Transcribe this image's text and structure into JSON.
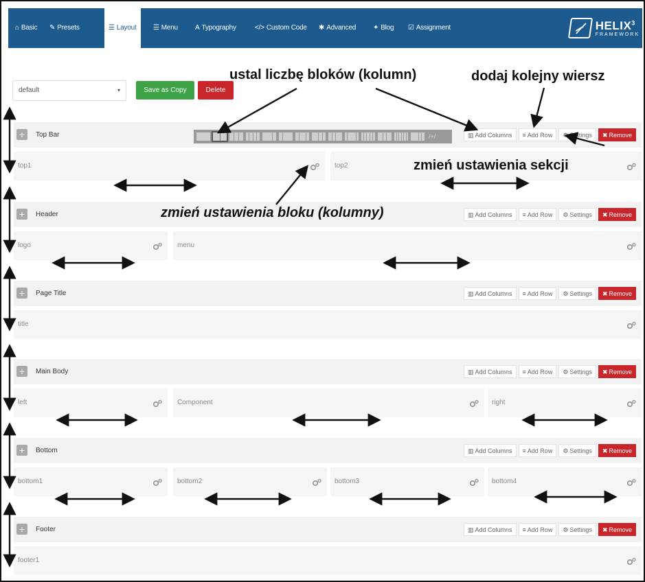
{
  "nav": {
    "items": [
      {
        "label": "Basic",
        "icon": "home-icon"
      },
      {
        "label": "Presets",
        "icon": "brush-icon"
      },
      {
        "label": "Layout",
        "icon": "layout-icon",
        "active": true
      },
      {
        "label": "Menu",
        "icon": "menu-icon"
      },
      {
        "label": "Typography",
        "icon": "font-icon"
      },
      {
        "label": "Custom Code",
        "icon": "code-icon"
      },
      {
        "label": "Advanced",
        "icon": "gear-icon"
      },
      {
        "label": "Blog",
        "icon": "thumbtack-icon"
      },
      {
        "label": "Assignment",
        "icon": "check-square-icon"
      }
    ],
    "logo": {
      "brand": "HELIX",
      "sub": "FRAMEWORK",
      "superscript": "3"
    }
  },
  "toolbar": {
    "layout_value": "default",
    "save_copy_label": "Save as Copy",
    "delete_label": "Delete"
  },
  "actions": {
    "add_columns": "Add Columns",
    "add_row": "Add Row",
    "settings": "Settings",
    "remove": "Remove"
  },
  "presets": {
    "custom_label": "/+/"
  },
  "sections": [
    {
      "title": "Top Bar",
      "columns": [
        "top1",
        "top2"
      ]
    },
    {
      "title": "Header",
      "columns": [
        "logo",
        "menu"
      ]
    },
    {
      "title": "Page Title",
      "columns": [
        "title"
      ]
    },
    {
      "title": "Main Body",
      "columns": [
        "left",
        "Component",
        "right"
      ]
    },
    {
      "title": "Bottom",
      "columns": [
        "bottom1",
        "bottom2",
        "bottom3",
        "bottom4"
      ]
    },
    {
      "title": "Footer",
      "columns": [
        "footer1"
      ]
    }
  ],
  "annotations": {
    "columns_count": "ustal liczbę bloków (kolumn)",
    "add_row": "dodaj kolejny wiersz",
    "section_settings": "zmień ustawienia sekcji",
    "block_settings": "zmień ustawienia bloku (kolumny)"
  },
  "colors": {
    "nav_bg": "#1d5b8e",
    "save_green": "#3ea346",
    "remove_red": "#c9262b"
  }
}
